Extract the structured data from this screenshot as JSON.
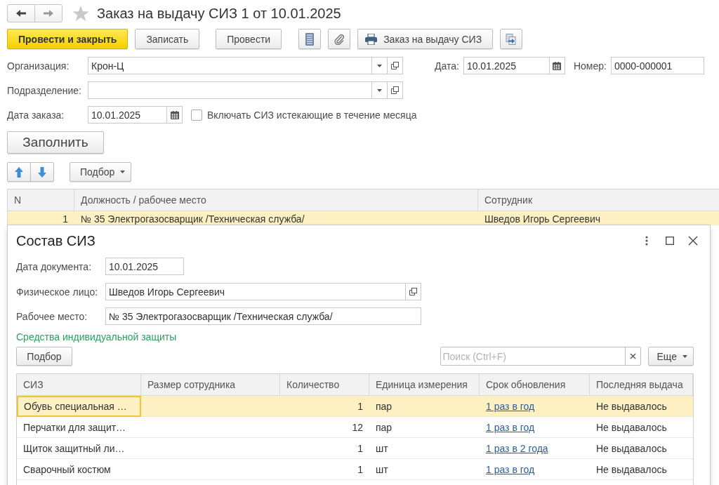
{
  "window": {
    "title": "Заказ на выдачу СИЗ 1 от 10.01.2025",
    "favorite": false
  },
  "toolbar": {
    "buttons": [
      {
        "kind": "primary",
        "label": "Провести и закрыть"
      },
      {
        "kind": "plain",
        "label": "Записать"
      },
      {
        "kind": "plain",
        "label": "Провести"
      },
      {
        "kind": "print",
        "label": "Заказ на выдачу СИЗ"
      }
    ]
  },
  "header": {
    "organization": {
      "label": "Организация:",
      "value": "Крон-Ц"
    },
    "date": {
      "label": "Дата:",
      "value": "10.01.2025"
    },
    "number": {
      "label": "Номер:",
      "value": "0000-000001"
    },
    "department": {
      "label": "Подразделение:"
    },
    "order_date": {
      "label": "Дата заказа:",
      "value": "10.01.2025"
    },
    "include_expiring": {
      "label": "Включать СИЗ истекающие в течение месяца",
      "checked": false
    }
  },
  "fill_button": "Заполнить",
  "table_toolbar": {
    "pick_button": "Подбор"
  },
  "table": {
    "columns": [
      "N",
      "Должность / рабочее место",
      "Сотрудник"
    ],
    "rows": [
      {
        "number": "1",
        "position": "№ 35 Электрогазосварщик /Техническая служба/",
        "employee": "Шведов Игорь Сергеевич",
        "selected": true
      }
    ]
  },
  "dialog": {
    "title": "Состав СИЗ",
    "document_date": {
      "label": "Дата документа:",
      "value": "10.01.2025"
    },
    "person": {
      "label": "Физическое лицо:",
      "value": "Шведов Игорь Сергеевич"
    },
    "workplace": {
      "label": "Рабочее место:",
      "value": "№ 35 Электрогазосварщик /Техническая служба/"
    },
    "section_title": "Средства индивидуальной защиты",
    "pick_button": "Подбор",
    "search": {
      "placeholder": "Поиск (Ctrl+F)"
    },
    "more_button": "Еще",
    "table": {
      "columns": [
        "СИЗ",
        "Размер сотрудника",
        "Количество",
        "Единица измерения",
        "Срок обновления",
        "Последняя выдача"
      ],
      "rows": [
        {
          "item": "Обувь специальная …",
          "quantity": "1",
          "unit": "пар",
          "period": "1 раз в год",
          "last_issue": "Не выдавалось",
          "selected": true
        },
        {
          "item": "Перчатки для защит…",
          "quantity": "12",
          "unit": "пар",
          "period": "1 раз в год",
          "last_issue": "Не выдавалось",
          "selected": false
        },
        {
          "item": "Щиток защитный ли…",
          "quantity": "1",
          "unit": "шт",
          "period": "1 раз в 2 года",
          "last_issue": "Не выдавалось",
          "selected": false
        },
        {
          "item": "Сварочный костюм",
          "quantity": "1",
          "unit": "шт",
          "period": "1 раз в год",
          "last_issue": "Не выдавалось",
          "selected": false
        }
      ]
    }
  }
}
